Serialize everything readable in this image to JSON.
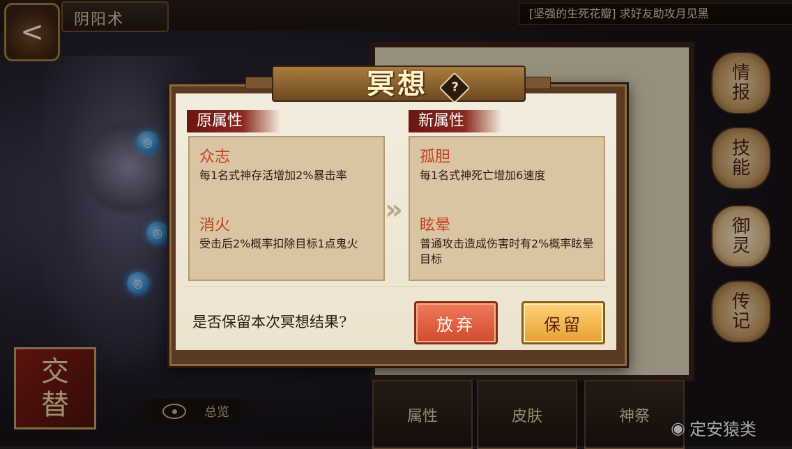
{
  "top": {
    "title": "阴阳术",
    "back_icon": "<",
    "announcement": "[坚强的生死花瓣] 求好友助攻月见黑"
  },
  "side_tabs": [
    {
      "label_line1": "情",
      "label_line2": "报"
    },
    {
      "label_line1": "技",
      "label_line2": "能"
    },
    {
      "label_line1": "御",
      "label_line2": "灵"
    },
    {
      "label_line1": "传",
      "label_line2": "记"
    }
  ],
  "bottom_tabs": [
    "属性",
    "皮肤",
    "神祭"
  ],
  "swap_badge": {
    "line1": "交",
    "line2": "替"
  },
  "overview_label": "总览",
  "watermark": "定安猿类",
  "dialog": {
    "title": "冥想",
    "help_icon": "?",
    "original_label": "原属性",
    "new_label": "新属性",
    "original": [
      {
        "name": "众志",
        "desc": "每1名式神存活增加2%暴击率"
      },
      {
        "name": "消火",
        "desc": "受击后2%概率扣除目标1点鬼火"
      }
    ],
    "new": [
      {
        "name": "孤胆",
        "desc": "每1名式神死亡增加6速度"
      },
      {
        "name": "眩晕",
        "desc": "普通攻击造成伤害时有2%概率眩晕目标"
      }
    ],
    "question": "是否保留本次冥想结果?",
    "discard_label": "放弃",
    "keep_label": "保留"
  },
  "colors": {
    "attr_name": "#c2401a",
    "discard_button": "#d24a30",
    "keep_button": "#e8a032"
  }
}
